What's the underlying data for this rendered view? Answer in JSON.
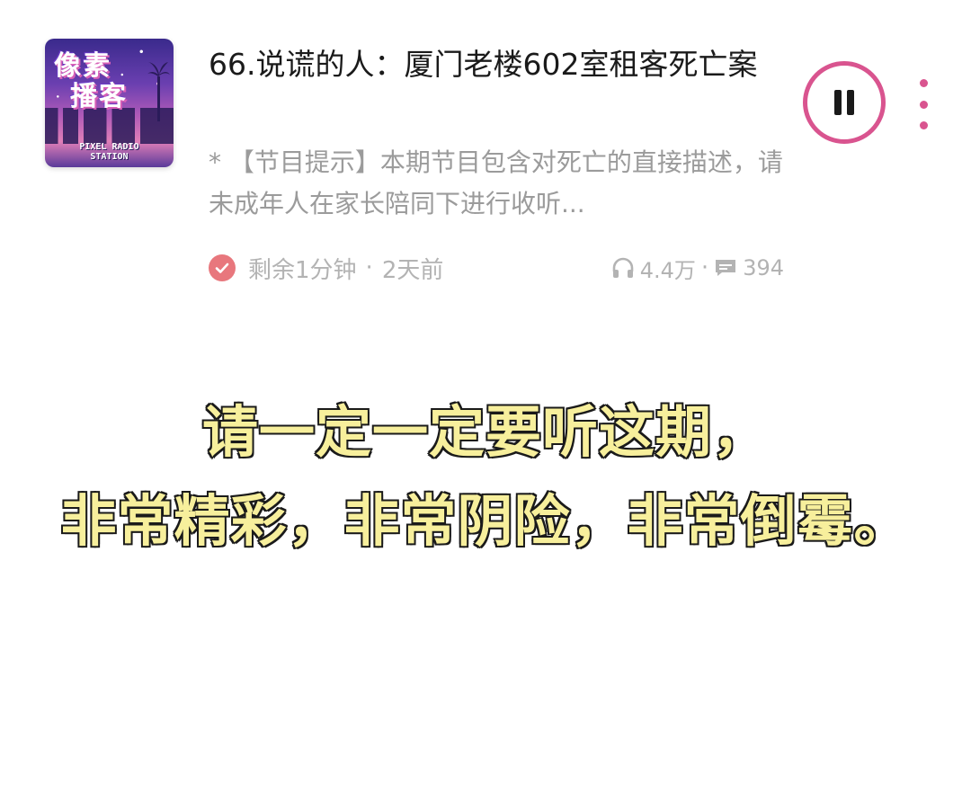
{
  "episode": {
    "cover": {
      "title_line1": "像素",
      "title_line2": "播客",
      "subtitle_line1": "PIXEL RADIO",
      "subtitle_line2": "STATION"
    },
    "title": "66.说谎的人：厦门老楼602室租客死亡案",
    "description": "* 【节目提示】本期节目包含对死亡的直接描述，请未成年人在家长陪同下进行收听...",
    "remaining": "剩余1分钟",
    "separator": "·",
    "published": "2天前",
    "plays": "4.4万",
    "comments": "394",
    "accent_color": "#d9548f",
    "played_check_color": "#e8777d"
  },
  "caption": {
    "line1": "请一定一定要听这期，",
    "line2": "非常精彩，非常阴险，非常倒霉。",
    "fill_color": "#f7ef9c",
    "stroke_color": "#1a1a1a"
  },
  "icons": {
    "played": "check-circle-icon",
    "plays": "headphones-icon",
    "comments": "comment-icon",
    "pause": "pause-icon",
    "more": "more-vertical-icon"
  }
}
